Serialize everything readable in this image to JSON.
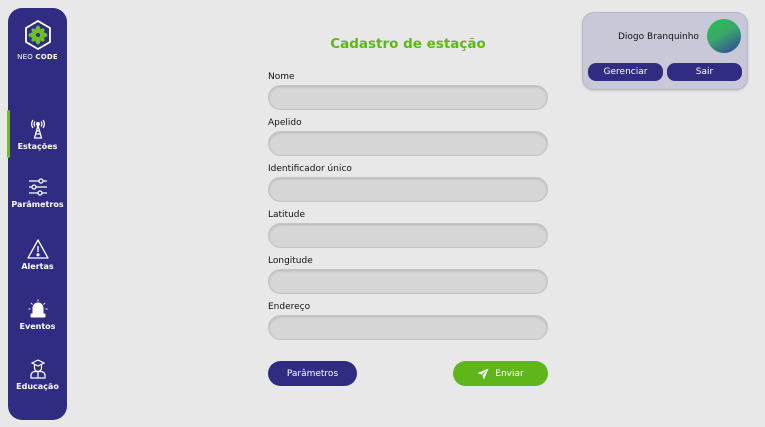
{
  "brand": {
    "logo_light": "NEO",
    "logo_bold": "CODE"
  },
  "sidebar": {
    "items": [
      {
        "label": "Estações",
        "icon": "antenna-tower-icon",
        "active": true
      },
      {
        "label": "Parâmetros",
        "icon": "sliders-icon"
      },
      {
        "label": "Alertas",
        "icon": "warning-triangle-icon"
      },
      {
        "label": "Eventos",
        "icon": "siren-icon"
      },
      {
        "label": "Educação",
        "icon": "student-icon"
      }
    ]
  },
  "form": {
    "title": "Cadastro de estação",
    "fields": [
      {
        "label": "Nome",
        "value": "",
        "placeholder": ""
      },
      {
        "label": "Apelido",
        "value": "",
        "placeholder": ""
      },
      {
        "label": "Identificador único",
        "value": "",
        "placeholder": ""
      },
      {
        "label": "Latitude",
        "value": "",
        "placeholder": ""
      },
      {
        "label": "Longitude",
        "value": "",
        "placeholder": ""
      },
      {
        "label": "Endereço",
        "value": "",
        "placeholder": ""
      }
    ],
    "params_button": "Parâmetros",
    "submit_button": "Enviar"
  },
  "user": {
    "name": "Diogo Branquinho",
    "manage_button": "Gerenciar",
    "exit_button": "Sair"
  },
  "colors": {
    "primary": "#2f2c82",
    "accent": "#5fb61b",
    "background": "#e8e8e8",
    "input": "#d6d6d6"
  }
}
